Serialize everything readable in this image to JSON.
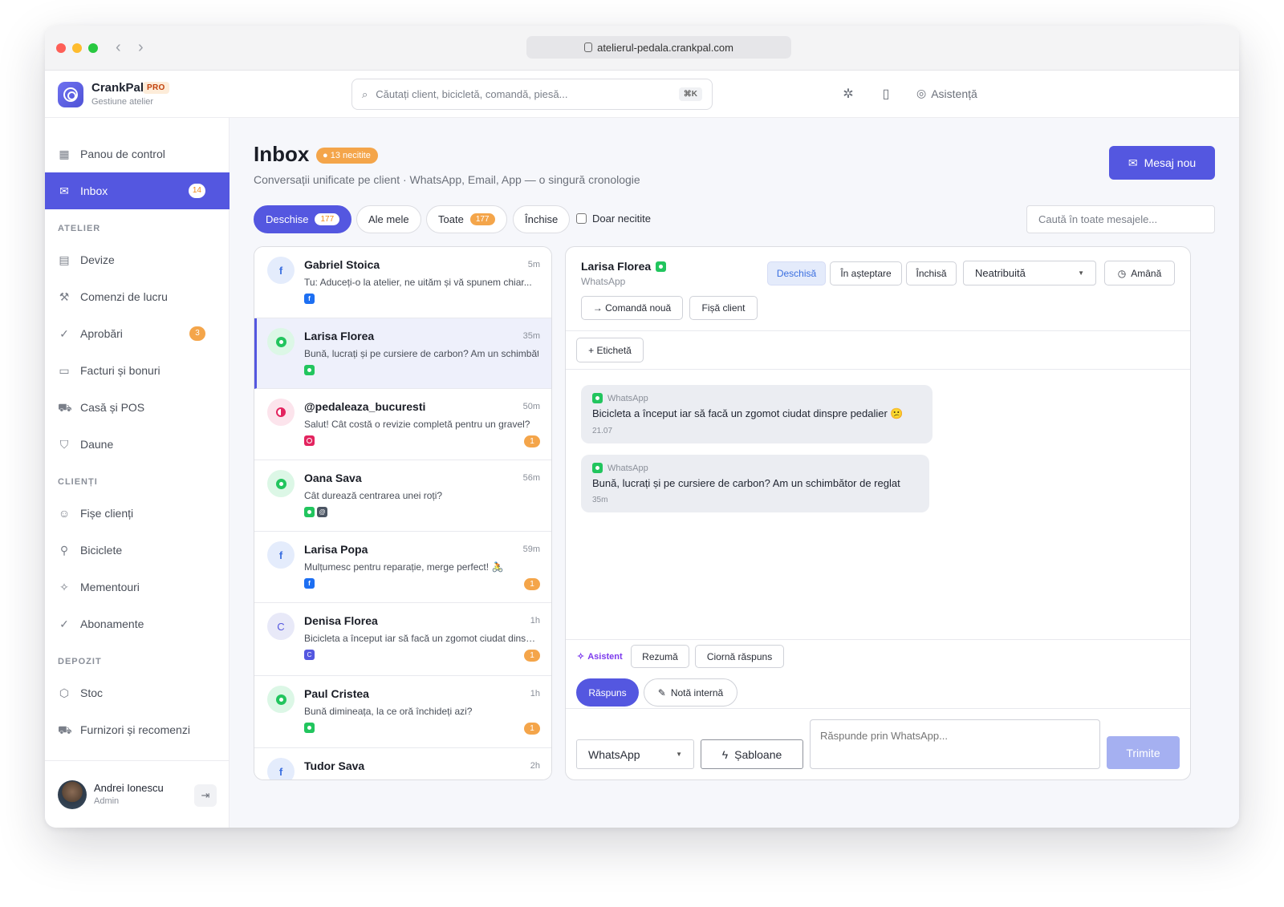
{
  "browser": {
    "url": "atelierul-pedala.crankpal.com"
  },
  "app": {
    "name": "CrankPal",
    "badge": "PRO",
    "subtitle": "Gestiune atelier"
  },
  "search": {
    "placeholder": "Căutați client, bicicletă, comandă, piesă...",
    "shortcut": "⌘K"
  },
  "topbar": {
    "help_label": "Asistență"
  },
  "sidebar": {
    "items": [
      {
        "label": "Panou de control",
        "icon": "grid-icon"
      },
      {
        "label": "Inbox",
        "icon": "inbox-icon",
        "badge": "14"
      }
    ],
    "sections": [
      {
        "title": "ATELIER",
        "items": [
          {
            "label": "Devize",
            "icon": "document-icon"
          },
          {
            "label": "Comenzi de lucru",
            "icon": "wrench-icon"
          },
          {
            "label": "Aprobări",
            "icon": "check-circle-icon",
            "badge": "3"
          },
          {
            "label": "Facturi și bonuri",
            "icon": "bill-icon"
          },
          {
            "label": "Casă și POS",
            "icon": "cart-icon"
          },
          {
            "label": "Daune",
            "icon": "shield-icon"
          }
        ]
      },
      {
        "title": "CLIENȚI",
        "items": [
          {
            "label": "Fișe clienți",
            "icon": "users-icon"
          },
          {
            "label": "Biciclete",
            "icon": "bike-icon"
          },
          {
            "label": "Mementouri",
            "icon": "sparkle-icon"
          },
          {
            "label": "Abonamente",
            "icon": "check-circle-icon"
          }
        ]
      },
      {
        "title": "DEPOZIT",
        "items": [
          {
            "label": "Stoc",
            "icon": "box-icon"
          },
          {
            "label": "Furnizori și recomenzi",
            "icon": "truck-icon"
          }
        ]
      }
    ],
    "user": {
      "name": "Andrei Ionescu",
      "role": "Admin"
    }
  },
  "page": {
    "title": "Inbox",
    "unread_pill": "13 necitite",
    "subtitle": "Conversații unificate pe client · WhatsApp, Email, App — o singură cronologie",
    "new_message": "Mesaj nou",
    "filters": [
      {
        "label": "Deschise",
        "count": "177"
      },
      {
        "label": "Ale mele"
      },
      {
        "label": "Toate",
        "count": "177"
      },
      {
        "label": "Închise"
      }
    ],
    "only_unread": "Doar necitite",
    "message_search": "Caută în toate mesajele..."
  },
  "conversations": [
    {
      "name": "Gabriel Stoica",
      "time": "5m",
      "preview": "Tu: Aduceți-o la atelier, ne uităm și vă spunem chiar...",
      "avatar": "f",
      "channels": [
        "fb"
      ],
      "unread": ""
    },
    {
      "name": "Larisa Florea",
      "time": "35m",
      "preview": "Bună, lucrați și pe cursiere de carbon? Am un schimbător de reglat",
      "avatar": "wa",
      "channels": [
        "wa"
      ],
      "unread": ""
    },
    {
      "name": "@pedaleaza_bucuresti",
      "time": "50m",
      "preview": "Salut! Cât costă o revizie completă pentru un gravel?",
      "avatar": "ig",
      "channels": [
        "ig"
      ],
      "unread": "1"
    },
    {
      "name": "Oana Sava",
      "time": "56m",
      "preview": "Cât durează centrarea unei roți?",
      "avatar": "wa",
      "channels": [
        "wa",
        "em"
      ],
      "unread": ""
    },
    {
      "name": "Larisa Popa",
      "time": "59m",
      "preview": "Mulțumesc pentru reparație, merge perfect! 🚴",
      "avatar": "f",
      "channels": [
        "fb"
      ],
      "unread": "1"
    },
    {
      "name": "Denisa Florea",
      "time": "1h",
      "preview": "Bicicleta a început iar să facă un zgomot ciudat dinspre pedalier",
      "avatar": "C",
      "channels": [
        "app"
      ],
      "unread": "1"
    },
    {
      "name": "Paul Cristea",
      "time": "1h",
      "preview": "Bună dimineața, la ce oră închideți azi?",
      "avatar": "wa",
      "channels": [
        "wa"
      ],
      "unread": "1"
    },
    {
      "name": "Tudor Sava",
      "time": "2h",
      "preview": "",
      "avatar": "f",
      "channels": [],
      "unread": ""
    }
  ],
  "detail": {
    "name": "Larisa Florea",
    "channel": "WhatsApp",
    "status_buttons": [
      "Deschisă",
      "În așteptare",
      "Închisă"
    ],
    "assignee": "Neatribuită",
    "snooze": "Amână",
    "new_order": "→ Comandă nouă",
    "client_card": "Fișă client",
    "add_tag": "+ Etichetă",
    "messages": [
      {
        "channel": "WhatsApp",
        "text": "Bicicleta a început iar să facă un zgomot ciudat dinspre pedalier 😕",
        "time": "21.07"
      },
      {
        "channel": "WhatsApp",
        "text": "Bună, lucrați și pe cursiere de carbon? Am un schimbător de reglat",
        "time": "35m"
      }
    ],
    "assistant_label": "Asistent",
    "summary": "Rezumă",
    "draft_reply": "Ciornă răspuns",
    "reply_tab": "Răspuns",
    "internal_note_tab": "Notă internă",
    "reply_channel": "WhatsApp",
    "templates": "Șabloane",
    "reply_placeholder": "Răspunde prin WhatsApp...",
    "send": "Trimite"
  },
  "colors": {
    "accent": "#5457e0",
    "warning": "#f4a54a",
    "whatsapp": "#22c55e",
    "facebook": "#1d6ff2",
    "instagram": "#e3245f"
  }
}
